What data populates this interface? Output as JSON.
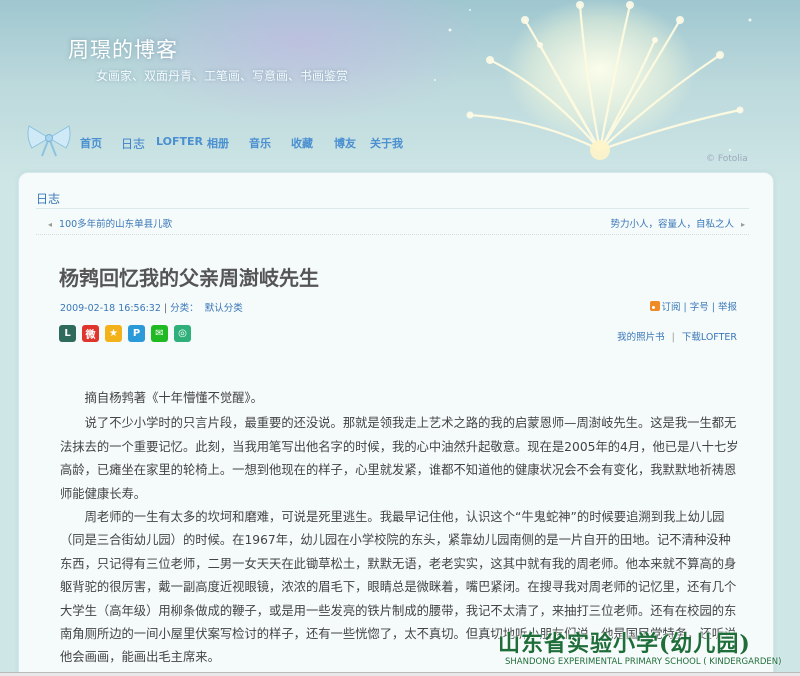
{
  "header": {
    "title": "周璟的博客",
    "subtitle": "女画家、双面丹青、工笔画、写意画、书画鉴赏",
    "copyright": "© Fotolia",
    "nav": [
      {
        "label": "首页"
      },
      {
        "label": "日志"
      },
      {
        "label": "LOFTER"
      },
      {
        "label": "相册"
      },
      {
        "label": "音乐"
      },
      {
        "label": "收藏"
      },
      {
        "label": "博友"
      },
      {
        "label": "关于我"
      }
    ]
  },
  "section": {
    "title": "日志",
    "prev_link": "100多年前的山东单县儿歌",
    "next_link": "势力小人，容量人，自私之人"
  },
  "post": {
    "title": "杨鹁回忆我的父亲周澍岐先生",
    "date": "2009-02-18 16:56:32",
    "category_label": "分类：",
    "category": "默认分类",
    "tools": "订阅 | 字号 | 举报",
    "photo_book": "我的照片书",
    "download_lofter": "下载LOFTER",
    "share_icons": [
      {
        "name": "lofter-icon",
        "glyph": "L",
        "color": "#2f6b5c"
      },
      {
        "name": "weibo-icon",
        "glyph": "微",
        "color": "#e0352c"
      },
      {
        "name": "qzone-icon",
        "glyph": "★",
        "color": "#f3b21a"
      },
      {
        "name": "tencent-weibo-icon",
        "glyph": "P",
        "color": "#2a9bd8"
      },
      {
        "name": "wechat-icon",
        "glyph": "✉",
        "color": "#1fb922"
      },
      {
        "name": "yixin-icon",
        "glyph": "◎",
        "color": "#2fb07a"
      }
    ],
    "paragraphs": [
      "摘自杨鹁著《十年懵懂不觉醒》。",
      "说了不少小学时的只言片段，最重要的还没说。那就是领我走上艺术之路的我的启蒙恩师—周澍岐先生。这是我一生都无法抹去的一个重要记忆。此刻，当我用笔写出他名字的时候，我的心中油然升起敬意。现在是2005年的4月，他已是八十七岁高龄，已瘫坐在家里的轮椅上。一想到他现在的样子，心里就发紧，谁都不知道他的健康状况会不会有变化，我默默地祈祷恩师能健康长寿。",
      "周老师的一生有太多的坎坷和磨难，可说是死里逃生。我最早记住他，认识这个“牛鬼蛇神”的时候要追溯到我上幼儿园（同是三合街幼儿园）的时候。在1967年，幼儿园在小学校院的东头，紧靠幼儿园南侧的是一片自开的田地。记不清种没种东西，只记得有三位老师，二男一女天天在此锄草松土，默默无语，老老实实，这其中就有我的周老师。他本来就不算高的身躯背驼的很厉害，戴一副高度近视眼镜，浓浓的眉毛下，眼睛总是微眯着，嘴巴紧闭。在搜寻我对周老师的记忆里，还有几个大学生（高年级）用柳条做成的鞭子，或是用一些发亮的铁片制成的腰带，我记不太清了，来抽打三位老师。还有在校园的东南角厕所边的一间小屋里伏案写检讨的样子，还有一些恍惚了，太不真切。但真切地听小朋友们说，他是国民党特务，还听说他会画画，能画出毛主席来。"
    ]
  },
  "overlay": {
    "school_cn": "山东省实验小学(幼儿园)",
    "school_en": "SHANDONG EXPERIMENTAL PRIMARY SCHOOL ( KINDERGARDEN)"
  }
}
